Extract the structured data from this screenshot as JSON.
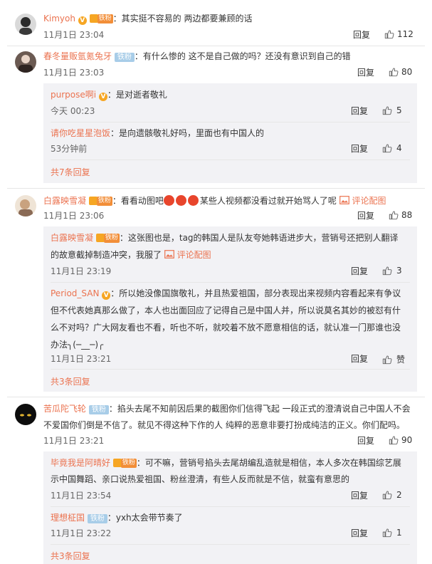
{
  "comments": [
    {
      "user": "Kimyoh",
      "text": "：其实挺不容易的 两边都要兼顾的话",
      "time": "11月1日 23:04",
      "reply": "回复",
      "likes": "112",
      "fan_badge": "铁粉"
    },
    {
      "user": "春冬量贩氩氪兔牙",
      "badge": "铁粉",
      "text": "：有什么惨的 这不是自己做的吗？还没有意识到自己的错",
      "time": "11月1日 23:03",
      "reply": "回复",
      "likes": "80",
      "subs": [
        {
          "user": "purpose啊i",
          "text": "：是对逝者敬礼",
          "time": "今天 00:23",
          "reply": "回复",
          "likes": "5"
        },
        {
          "user": "请你吃星星泡饭",
          "text": "：是向遗骸敬礼好吗，里面也有中国人的",
          "time": "53分钟前",
          "reply": "回复",
          "likes": "4"
        }
      ],
      "more": "共7条回复"
    },
    {
      "user": "白露映雪凝",
      "fan_badge": "铁粉",
      "text_pre": "：看看动图吧",
      "text_post": "某些人视频都没看过就开始骂人了呢",
      "link": "评论配图",
      "time": "11月1日 23:06",
      "reply": "回复",
      "likes": "88",
      "subs": [
        {
          "user": "白露映雪凝",
          "fan_badge": "铁粉",
          "line1": "：这张图也是，tag的韩国人是队友夸她韩语进步大，营销号还把别人翻译",
          "line2": "的故意截掉制造冲突，我服了",
          "link": "评论配图",
          "time": "11月1日 23:19",
          "reply": "回复",
          "likes": "3"
        },
        {
          "user": "Period_SAN",
          "line1": "：所以她没像国旗敬礼，并且热爱祖国，部分表现出来视频内容看起来有争议",
          "line2": "但不代表她真那么做了，本人也出面回应了记得自己是中国人并，所以说莫名其妙的被怼有什",
          "line3": "么不对吗？广大网友看也不看，听也不听，就咬着不放不愿意相信的话，就认准一门那谁也没",
          "line4": "办法╮(─__─)╭",
          "time": "11月1日 23:21",
          "reply": "回复",
          "likes": "赞"
        }
      ],
      "more": "共3条回复"
    },
    {
      "user": "苦瓜陀飞轮",
      "badge": "铁粉",
      "line1": "：掐头去尾不知前因后果的截图你们信得飞起 一段正式的澄清说自己中国人不会",
      "line2": "不爱国你们倒是不信了。就见不得这种下作的人 纯粹的恶意非要打扮成纯洁的正义。你们配吗。",
      "time": "11月1日 23:21",
      "reply": "回复",
      "likes": "90",
      "subs": [
        {
          "user": "毕竟我是阿晴好",
          "fan_badge": "铁粉",
          "line1": "：可不嘛，营销号掐头去尾胡编乱造就是相信，本人多次在韩国综艺展",
          "line2": "示中国舞蹈、亲口说热爱祖国、粉丝澄清，有些人反而就是不信，就蛮有意思的",
          "time": "11月1日 23:54",
          "reply": "回复",
          "likes": "2"
        },
        {
          "user": "理想柾国",
          "badge": "铁粉",
          "text": "：yxh太会带节奏了",
          "time": "11月1日 23:22",
          "reply": "回复",
          "likes": "1"
        }
      ],
      "more": "共3条回复"
    }
  ],
  "colors": {
    "name": "#eb7350",
    "subbg": "#f2f2f5",
    "fan": "#f28e38",
    "blue_badge": "#a8cde8"
  }
}
